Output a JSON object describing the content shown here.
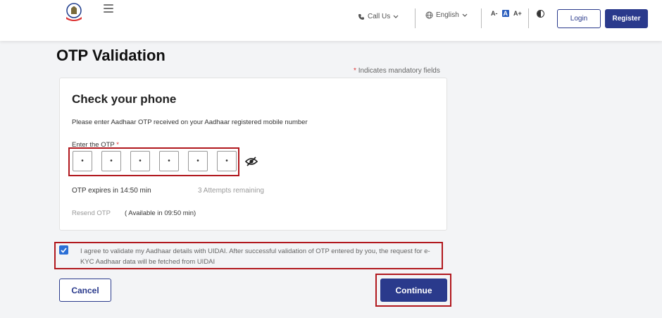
{
  "header": {
    "call_us": "Call Us",
    "language": "English",
    "font_small": "A-",
    "font_normal": "A",
    "font_large": "A+",
    "login": "Login",
    "register": "Register"
  },
  "page": {
    "title": "OTP Validation",
    "mandatory_star": "*",
    "mandatory_text": "Indicates mandatory fields"
  },
  "card": {
    "title": "Check your phone",
    "description": "Please enter Aadhaar OTP received on your Aadhaar registered mobile number",
    "otp_label": "Enter the OTP",
    "otp_star": "*",
    "otp_digits": [
      "•",
      "•",
      "•",
      "•",
      "•",
      "•"
    ],
    "expires": "OTP expires in 14:50 min",
    "attempts": "3 Attempts remaining",
    "resend": "Resend OTP",
    "available": "( Available in 09:50 min)"
  },
  "consent": {
    "checked": true,
    "text": "I agree to validate my Aadhaar details with UIDAI. After successful validation of OTP entered by you, the request for e-KYC Aadhaar data will be fetched from UIDAI"
  },
  "actions": {
    "cancel": "Cancel",
    "continue": "Continue"
  },
  "colors": {
    "primary": "#2a3a8c",
    "highlight": "#b1181e",
    "checkbox": "#2b6fd6"
  }
}
